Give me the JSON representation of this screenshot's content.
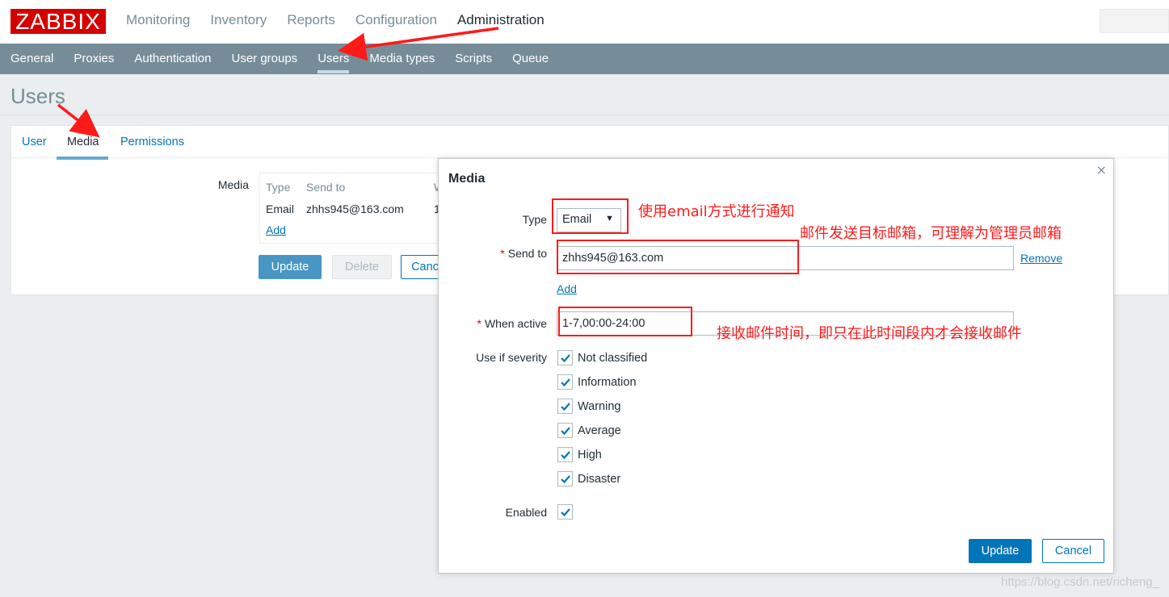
{
  "app": {
    "logo": "ZABBIX",
    "top_menu": [
      "Monitoring",
      "Inventory",
      "Reports",
      "Configuration",
      "Administration"
    ],
    "top_menu_active": "Administration",
    "sub_menu": [
      "General",
      "Proxies",
      "Authentication",
      "User groups",
      "Users",
      "Media types",
      "Scripts",
      "Queue"
    ],
    "sub_menu_active": "Users"
  },
  "page": {
    "title": "Users",
    "tabs": [
      "User",
      "Media",
      "Permissions"
    ],
    "active_tab": "Media",
    "media_label": "Media",
    "media_table": {
      "columns": [
        "Type",
        "Send to",
        "W"
      ],
      "rows": [
        {
          "type": "Email",
          "send_to": "zhhs945@163.com",
          "when": "1"
        }
      ],
      "add_link": "Add"
    },
    "buttons": {
      "update": "Update",
      "delete": "Delete",
      "cancel": "Canc"
    }
  },
  "modal": {
    "title": "Media",
    "close_glyph": "×",
    "type_label": "Type",
    "type_value": "Email",
    "send_to_label": "Send to",
    "send_to_value": "zhhs945@163.com",
    "remove_link": "Remove",
    "add_link": "Add",
    "when_active_label": "When active",
    "when_active_value": "1-7,00:00-24:00",
    "severity_label": "Use if severity",
    "severities": [
      {
        "label": "Not classified",
        "checked": true
      },
      {
        "label": "Information",
        "checked": true
      },
      {
        "label": "Warning",
        "checked": true
      },
      {
        "label": "Average",
        "checked": true
      },
      {
        "label": "High",
        "checked": true
      },
      {
        "label": "Disaster",
        "checked": true
      }
    ],
    "enabled_label": "Enabled",
    "enabled_checked": true,
    "update_button": "Update",
    "cancel_button": "Cancel"
  },
  "annotations": {
    "type_note": "使用email方式进行通知",
    "send_to_note": "邮件发送目标邮箱，可理解为管理员邮箱",
    "when_active_note": "接收邮件时间，即只在此时间段内才会接收邮件",
    "color": "#ff1a1a"
  },
  "watermark": "https://blog.csdn.net/richeng_"
}
